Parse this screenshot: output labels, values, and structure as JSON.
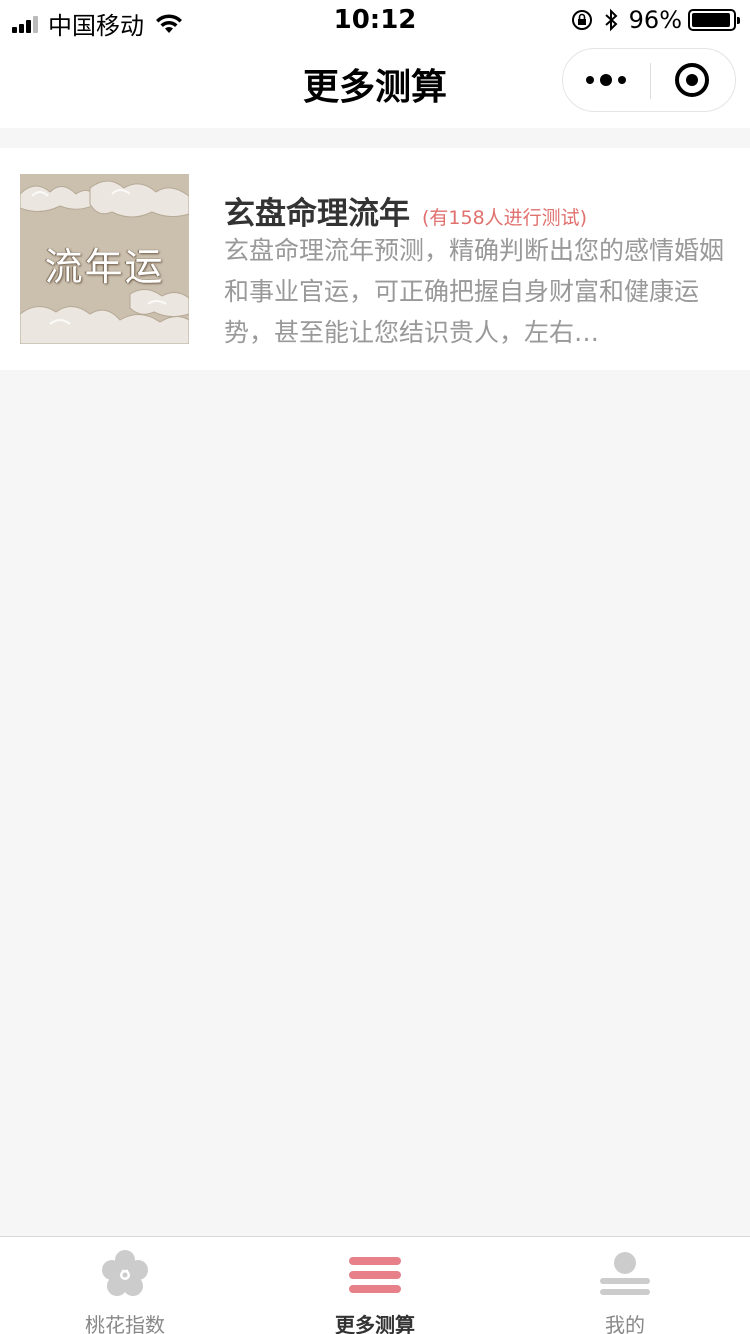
{
  "status_bar": {
    "carrier": "中国移动",
    "time": "10:12",
    "battery": "96%",
    "battery_level": 0.96
  },
  "nav": {
    "title": "更多测算"
  },
  "list": [
    {
      "thumb_text": "流年运",
      "title": "玄盘命理流年",
      "count": "(有158人进行测试)",
      "desc": "玄盘命理流年预测，精确判断出您的感情婚姻和事业官运，可正确把握自身财富和健康运势，甚至能让您结识贵人，左右…"
    }
  ],
  "tab_bar": {
    "tabs": [
      {
        "label": "桃花指数",
        "icon": "flower-icon",
        "active": false
      },
      {
        "label": "更多测算",
        "icon": "menu-icon",
        "active": true
      },
      {
        "label": "我的",
        "icon": "user-icon",
        "active": false
      }
    ]
  },
  "colors": {
    "accent": "#e8808a",
    "count_text": "#e0716f",
    "inactive_icon": "#cccccc"
  }
}
